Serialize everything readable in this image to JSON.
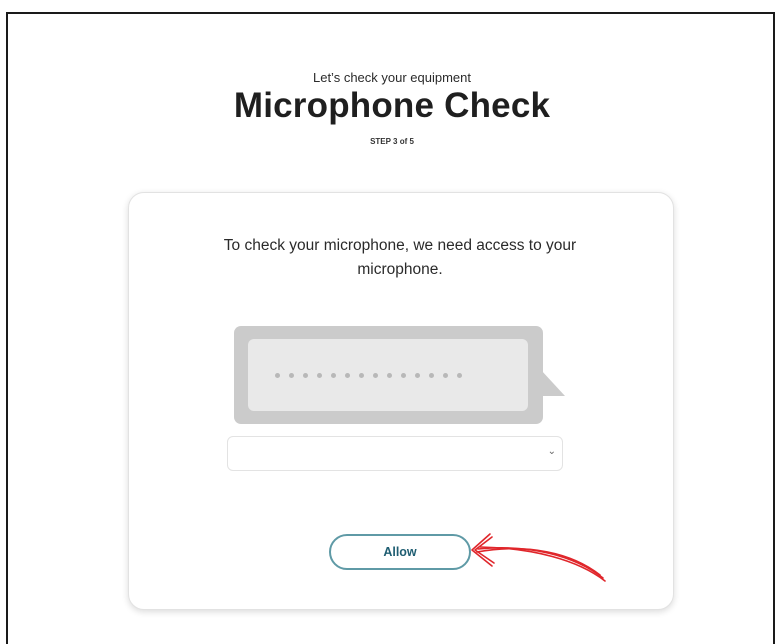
{
  "header": {
    "subtitle": "Let’s check your equipment",
    "title": "Microphone Check",
    "step": "STEP 3 of 5"
  },
  "card": {
    "message": "To check your microphone, we need access to your microphone.",
    "microphone_select": {
      "selected_value": "",
      "icon": "chevron-down-icon"
    },
    "allow_label": "Allow"
  },
  "colors": {
    "button_border": "#5f9aa6",
    "button_text": "#1f5e72",
    "annotation_arrow": "#e0262b"
  }
}
